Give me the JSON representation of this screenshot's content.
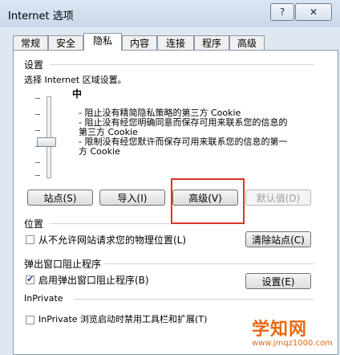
{
  "window": {
    "title": "Internet 选项",
    "help_label": "?",
    "close_label": "✕"
  },
  "tabs": [
    {
      "label": "常规"
    },
    {
      "label": "安全"
    },
    {
      "label": "隐私",
      "active": true
    },
    {
      "label": "内容"
    },
    {
      "label": "连接"
    },
    {
      "label": "程序"
    },
    {
      "label": "高级"
    }
  ],
  "settings": {
    "group_title": "设置",
    "instruction": "选择 Internet 区域设置。",
    "level": "中",
    "slider_value": "中",
    "bullets": [
      {
        "text": "- 阻止没有精简隐私策略的第三方 Cookie"
      },
      {
        "text": "- 阻止没有经您明确同意而保存可用来联系您的信息的第三方 Cookie"
      },
      {
        "text": "- 限制没有经您默许而保存可用来联系您的信息的第一方 Cookie"
      }
    ],
    "buttons": {
      "sites": "站点(S)",
      "import": "导入(I)",
      "advanced": "高级(V)",
      "default": "默认值(D)"
    }
  },
  "location": {
    "group_title": "位置",
    "checkbox_label": "从不允许网站请求您的物理位置(L)",
    "checked": false,
    "clear_button": "清除站点(C)"
  },
  "popup": {
    "group_title": "弹出窗口阻止程序",
    "checkbox_label": "启用弹出窗口阻止程序(B)",
    "checked": true,
    "settings_button": "设置(E)"
  },
  "inprivate": {
    "group_title": "InPrivate",
    "checkbox_label": "InPrivate 浏览启动时禁用工具栏和扩展(T)",
    "checked": false
  },
  "watermark": {
    "big": "学知网",
    "small": "www.jmqz1000.com"
  },
  "colors": {
    "highlight": "#d9362b",
    "watermark": "#e86a12"
  }
}
